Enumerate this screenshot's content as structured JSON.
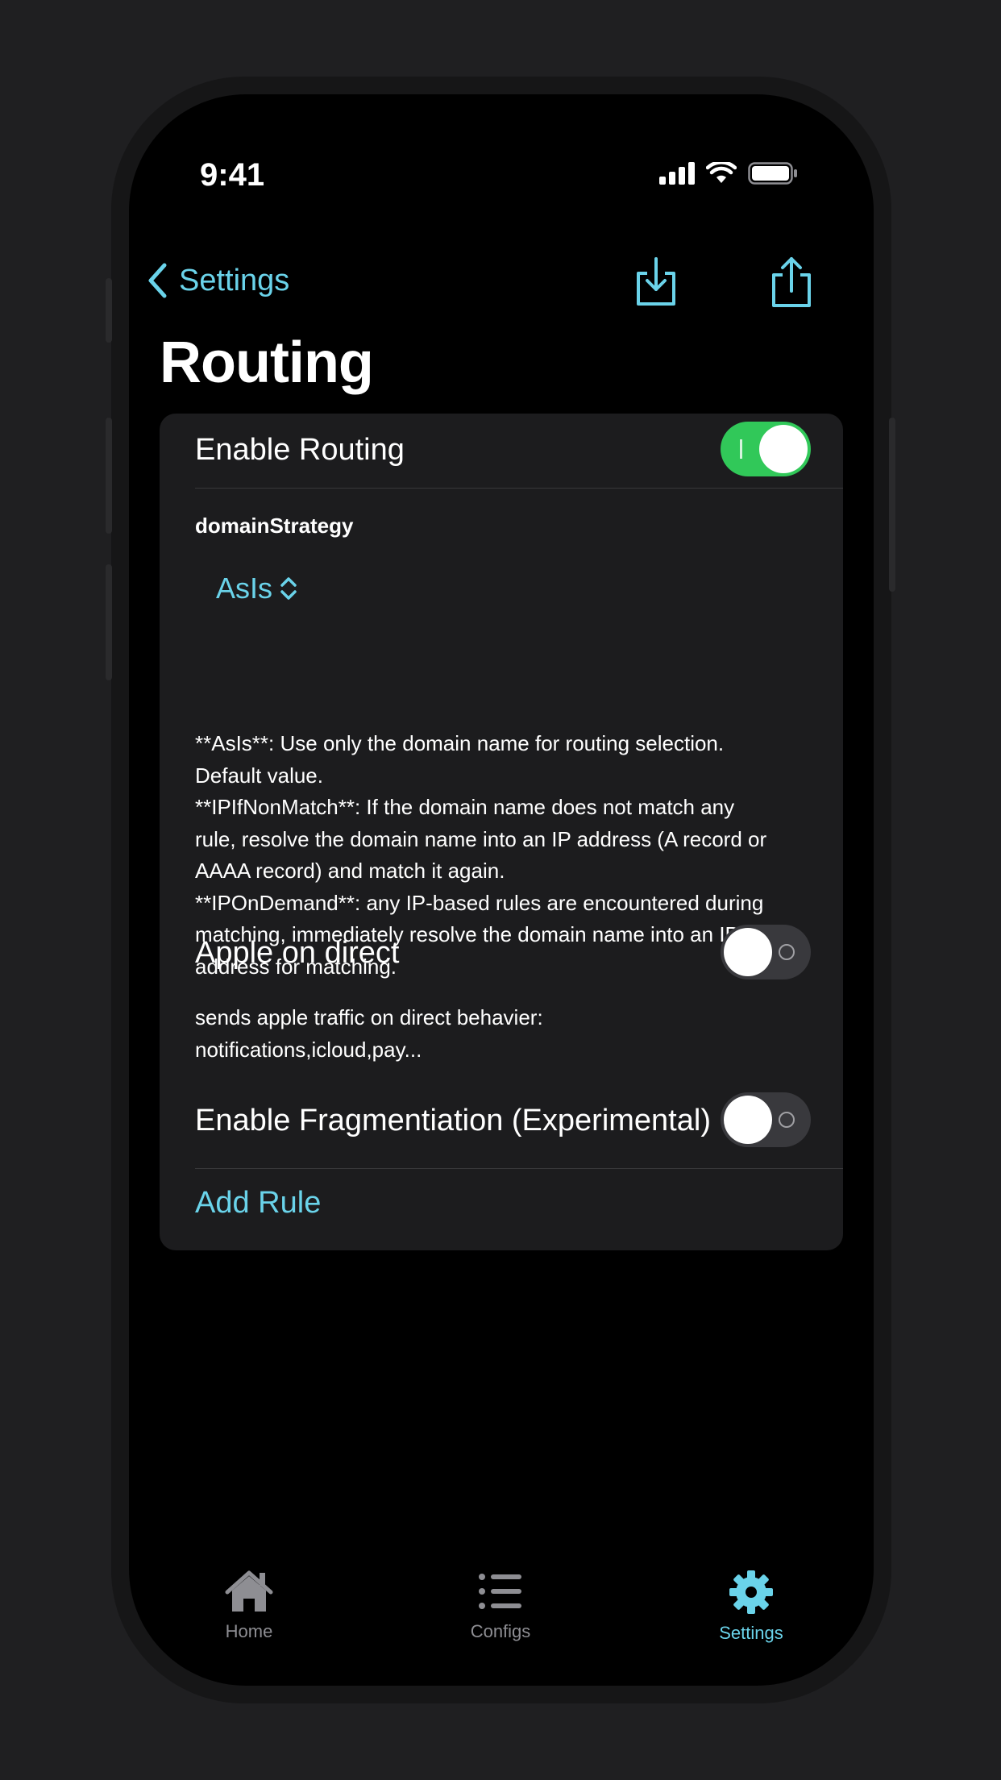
{
  "status_bar": {
    "time": "9:41"
  },
  "nav": {
    "back_label": "Settings",
    "title": "Routing"
  },
  "routing": {
    "enable_label": "Enable Routing",
    "enable_on": true,
    "domain_strategy_label": "domainStrategy",
    "domain_strategy_value": "AsIs",
    "description_lines": [
      "**AsIs**: Use only the domain name for routing selection.",
      "Default value.",
      "**IPIfNonMatch**: If the domain name does not match any",
      "rule, resolve the domain name into an IP address (A record or",
      "AAAA record) and match it again.",
      "**IPOnDemand**: any IP-based rules are encountered during",
      "matching, immediately resolve the domain name into an IP",
      "address for matching."
    ],
    "apple_direct_label": "Apple on direct",
    "apple_direct_on": false,
    "apple_direct_desc_lines": [
      "sends apple traffic on direct behavier:",
      "notifications,icloud,pay..."
    ],
    "fragmentation_label": "Enable Fragmentiation (Experimental)",
    "fragmentation_on": false,
    "add_rule_label": "Add Rule"
  },
  "tabs": [
    {
      "label": "Home",
      "icon": "house-icon",
      "active": false
    },
    {
      "label": "Configs",
      "icon": "list-icon",
      "active": false
    },
    {
      "label": "Settings",
      "icon": "gear-icon",
      "active": true
    }
  ],
  "colors": {
    "accent": "#6ad3ea",
    "toggle_on": "#31c859",
    "toggle_off": "#39393d",
    "card": "#1c1c1e",
    "tab_inactive": "#8e8e93"
  }
}
